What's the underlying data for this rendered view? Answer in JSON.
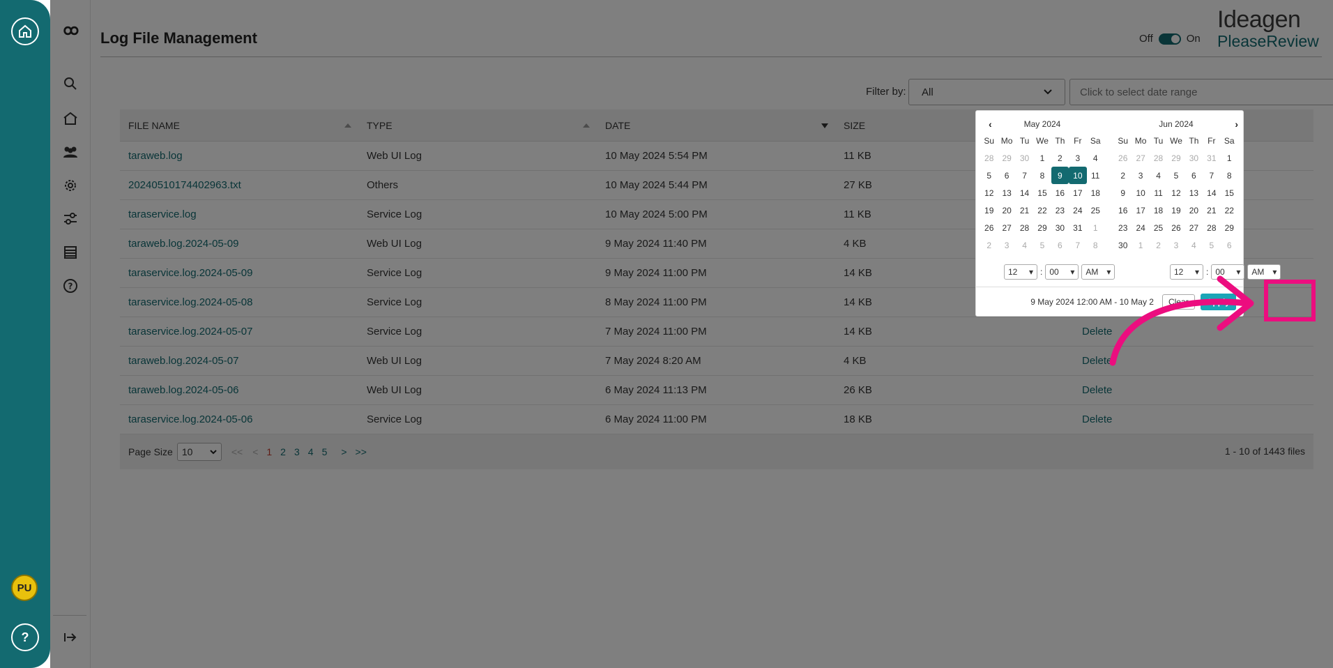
{
  "header": {
    "title": "Log File Management",
    "toggle_off": "Off",
    "toggle_on": "On",
    "logo_top": "Ideagen",
    "logo_bottom": "PleaseReview"
  },
  "rail": {
    "avatar": "PU",
    "help": "?"
  },
  "filters": {
    "label": "Filter by:",
    "type_value": "All",
    "date_placeholder": "Click to select date range"
  },
  "table": {
    "columns": [
      "FILE NAME",
      "TYPE",
      "DATE",
      "SIZE"
    ],
    "rows": [
      {
        "name": "taraweb.log",
        "type": "Web UI Log",
        "date": "10 May 2024 5:54 PM",
        "size": "11 KB",
        "action": ""
      },
      {
        "name": "20240510174402963.txt",
        "type": "Others",
        "date": "10 May 2024 5:44 PM",
        "size": "27 KB",
        "action": ""
      },
      {
        "name": "taraservice.log",
        "type": "Service Log",
        "date": "10 May 2024 5:00 PM",
        "size": "11 KB",
        "action": ""
      },
      {
        "name": "taraweb.log.2024-05-09",
        "type": "Web UI Log",
        "date": "9 May 2024 11:40 PM",
        "size": "4 KB",
        "action": ""
      },
      {
        "name": "taraservice.log.2024-05-09",
        "type": "Service Log",
        "date": "9 May 2024 11:00 PM",
        "size": "14 KB",
        "action": ""
      },
      {
        "name": "taraservice.log.2024-05-08",
        "type": "Service Log",
        "date": "8 May 2024 11:00 PM",
        "size": "14 KB",
        "action": ""
      },
      {
        "name": "taraservice.log.2024-05-07",
        "type": "Service Log",
        "date": "7 May 2024 11:00 PM",
        "size": "14 KB",
        "action": "Delete"
      },
      {
        "name": "taraweb.log.2024-05-07",
        "type": "Web UI Log",
        "date": "7 May 2024 8:20 AM",
        "size": "4 KB",
        "action": "Delete"
      },
      {
        "name": "taraweb.log.2024-05-06",
        "type": "Web UI Log",
        "date": "6 May 2024 11:13 PM",
        "size": "26 KB",
        "action": "Delete"
      },
      {
        "name": "taraservice.log.2024-05-06",
        "type": "Service Log",
        "date": "6 May 2024 11:00 PM",
        "size": "18 KB",
        "action": "Delete"
      }
    ]
  },
  "pager": {
    "label": "Page Size",
    "size": "10",
    "first": "<<",
    "prev": "<",
    "pages": [
      "1",
      "2",
      "3",
      "4",
      "5"
    ],
    "next": ">",
    "last": ">>",
    "count": "1 - 10 of 1443 files"
  },
  "picker": {
    "left_month": "May 2024",
    "right_month": "Jun 2024",
    "days": [
      "Su",
      "Mo",
      "Tu",
      "We",
      "Th",
      "Fr",
      "Sa"
    ],
    "left_weeks": [
      [
        "28",
        "29",
        "30",
        "1",
        "2",
        "3",
        "4"
      ],
      [
        "5",
        "6",
        "7",
        "8",
        "9",
        "10",
        "11"
      ],
      [
        "12",
        "13",
        "14",
        "15",
        "16",
        "17",
        "18"
      ],
      [
        "19",
        "20",
        "21",
        "22",
        "23",
        "24",
        "25"
      ],
      [
        "26",
        "27",
        "28",
        "29",
        "30",
        "31",
        "1"
      ],
      [
        "2",
        "3",
        "4",
        "5",
        "6",
        "7",
        "8"
      ]
    ],
    "right_weeks": [
      [
        "26",
        "27",
        "28",
        "29",
        "30",
        "31",
        "1"
      ],
      [
        "2",
        "3",
        "4",
        "5",
        "6",
        "7",
        "8"
      ],
      [
        "9",
        "10",
        "11",
        "12",
        "13",
        "14",
        "15"
      ],
      [
        "16",
        "17",
        "18",
        "19",
        "20",
        "21",
        "22"
      ],
      [
        "23",
        "24",
        "25",
        "26",
        "27",
        "28",
        "29"
      ],
      [
        "30",
        "1",
        "2",
        "3",
        "4",
        "5",
        "6"
      ]
    ],
    "hour": "12",
    "minute": "00",
    "ampm": "AM",
    "range_text": "9 May 2024 12:00 AM - 10 May 2",
    "clear_label": "Clear",
    "apply_label": "Apply"
  },
  "colors": {
    "brand": "#136a70",
    "apply": "#1aa6b7",
    "highlight": "#ec0d7f"
  }
}
